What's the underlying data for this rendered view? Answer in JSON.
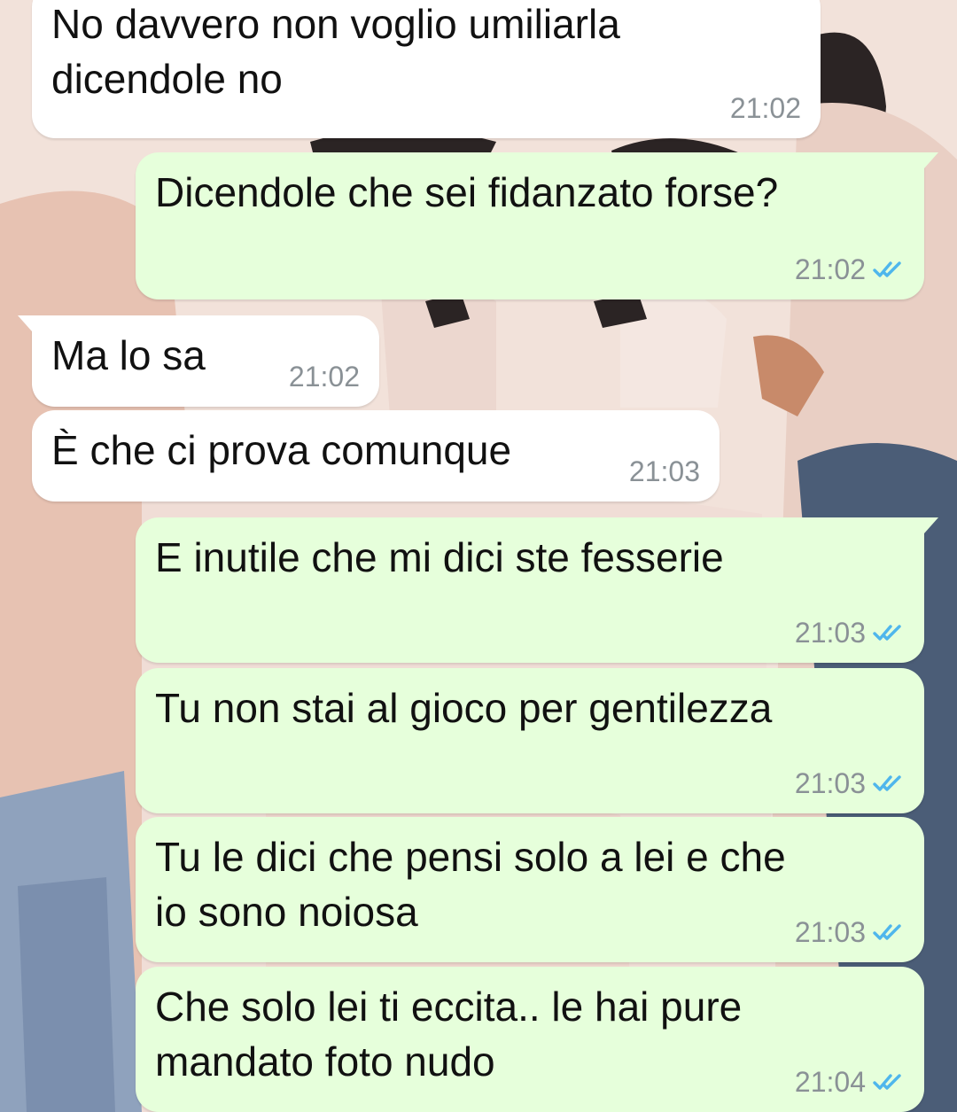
{
  "colors": {
    "incoming_bubble": "#ffffff",
    "outgoing_bubble": "#e6ffdb",
    "timestamp": "#8a9196",
    "read_ticks": "#4fb6ec"
  },
  "messages": [
    {
      "direction": "incoming",
      "text": "No davvero non voglio umiliarla\ndicendole no",
      "time": "21:02"
    },
    {
      "direction": "outgoing",
      "text": "Dicendole che sei fidanzato forse?",
      "time": "21:02",
      "status_icon": "double-check-read-icon"
    },
    {
      "direction": "incoming",
      "text": "Ma lo sa",
      "time": "21:02"
    },
    {
      "direction": "incoming",
      "text": "È che ci prova comunque",
      "time": "21:03"
    },
    {
      "direction": "outgoing",
      "text": "E inutile che mi dici ste fesserie",
      "time": "21:03",
      "status_icon": "double-check-read-icon"
    },
    {
      "direction": "outgoing",
      "text": "Tu non stai al gioco per gentilezza",
      "time": "21:03",
      "status_icon": "double-check-read-icon"
    },
    {
      "direction": "outgoing",
      "text": "Tu le dici che pensi solo a lei e che\nio sono noiosa",
      "time": "21:03",
      "status_icon": "double-check-read-icon"
    },
    {
      "direction": "outgoing",
      "text": "Che solo lei ti eccita.. le hai pure\nmandato foto nudo",
      "time": "21:04",
      "status_icon": "double-check-read-icon"
    }
  ]
}
